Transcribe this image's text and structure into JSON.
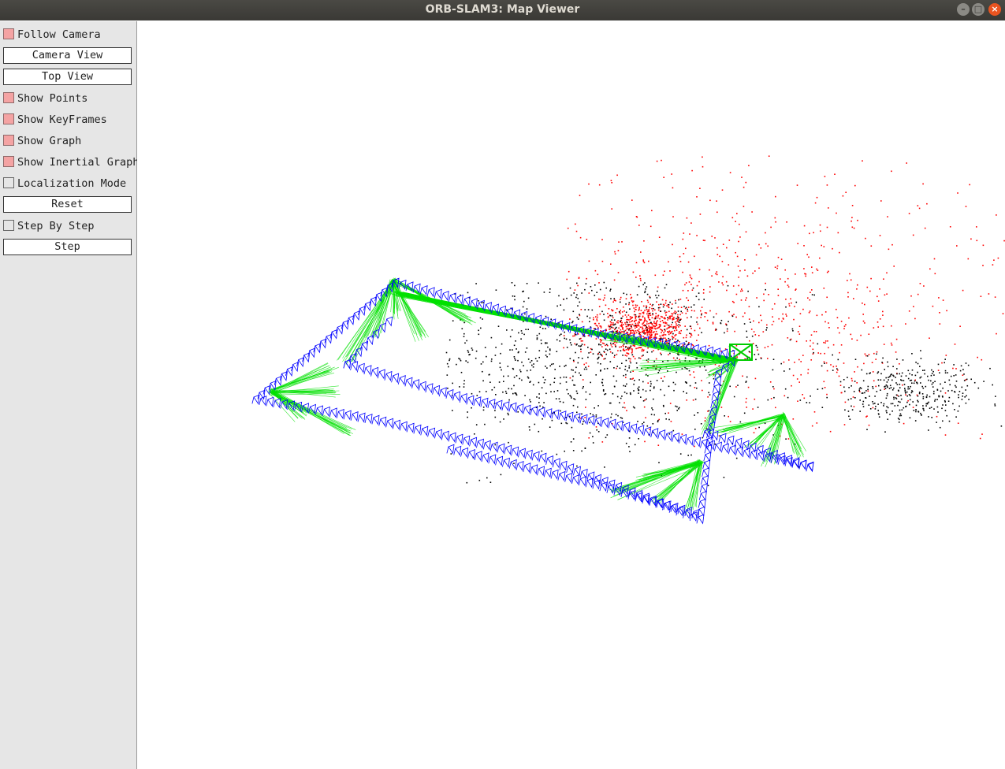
{
  "window": {
    "title": "ORB-SLAM3: Map Viewer",
    "controls": [
      "minimize",
      "maximize",
      "close"
    ]
  },
  "panel": {
    "follow_camera": {
      "label": "Follow Camera",
      "checked": true
    },
    "camera_view": {
      "label": "Camera View"
    },
    "top_view": {
      "label": "Top View"
    },
    "show_points": {
      "label": "Show Points",
      "checked": true
    },
    "show_keyframes": {
      "label": "Show KeyFrames",
      "checked": true
    },
    "show_graph": {
      "label": "Show Graph",
      "checked": true
    },
    "show_inertial_graph": {
      "label": "Show Inertial Graph",
      "checked": true
    },
    "localization_mode": {
      "label": "Localization Mode",
      "checked": false
    },
    "reset": {
      "label": "Reset"
    },
    "step_by_step": {
      "label": "Step By Step",
      "checked": false
    },
    "step": {
      "label": "Step"
    }
  },
  "colors": {
    "checkbox_on": "#f4a3a3",
    "keyframe": "#0000ff",
    "graph_edge": "#00e000",
    "current_camera": "#00cc00",
    "map_point_reference": "#ff0000",
    "map_point": "#000000",
    "close_button": "#e95420"
  }
}
